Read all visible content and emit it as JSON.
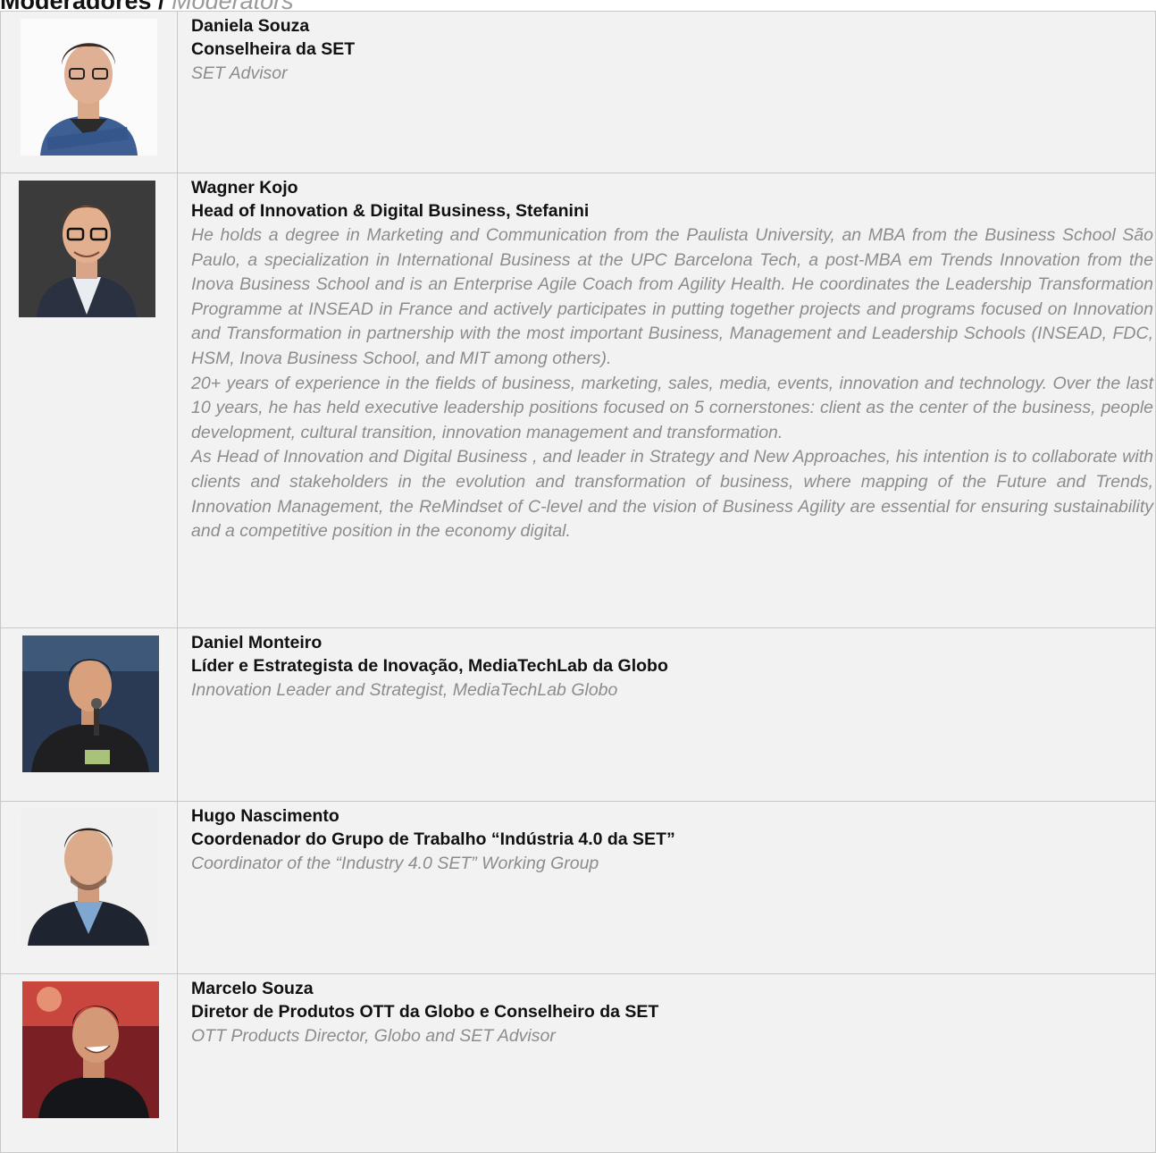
{
  "heading": {
    "pt": "Moderadores",
    "sep": " / ",
    "en": "Moderators"
  },
  "people": [
    {
      "photo": "portrait-photo",
      "name": "Daniela Souza",
      "role": "Conselheira da SET",
      "bio": [
        "SET Advisor"
      ]
    },
    {
      "photo": "portrait-photo",
      "name": "Wagner Kojo",
      "role": "Head of Innovation & Digital Business, Stefanini",
      "bio": [
        "He holds a degree in Marketing and Communication from the Paulista University, an MBA from the Business School São Paulo, a specialization in International Business at the UPC Barcelona Tech, a post-MBA em Trends Innovation from the Inova Business School and is an Enterprise Agile Coach from Agility Health. He coordinates the Leadership Transformation Programme at INSEAD in France and actively participates in putting together projects and programs focused on Innovation and Transformation in partnership with the most important Business, Management and Leadership Schools (INSEAD, FDC, HSM, Inova Business School, and MIT among others).",
        "20+ years of experience in the fields of business, marketing, sales, media, events, innovation and technology. Over the last 10 years, he has held executive leadership positions focused on 5 cornerstones: client as the center of the business, people development, cultural transition, innovation management and transformation.",
        "As Head of Innovation and Digital Business , and leader in Strategy and New Approaches, his intention is to collaborate with clients and stakeholders in the evolution and transformation of business, where mapping of the Future and Trends, Innovation Management, the ReMindset of C-level and the vision of Business Agility are essential for ensuring sustainability and a competitive position in the economy digital."
      ]
    },
    {
      "photo": "portrait-photo",
      "name": "Daniel Monteiro",
      "role": "Líder e Estrategista de Inovação, MediaTechLab da Globo",
      "bio": [
        "Innovation Leader and Strategist, MediaTechLab Globo"
      ]
    },
    {
      "photo": "portrait-photo",
      "name": "Hugo Nascimento",
      "role": "Coordenador do Grupo de Trabalho “Indústria 4.0 da SET”",
      "bio": [
        "Coordinator of the “Industry 4.0 SET” Working Group"
      ]
    },
    {
      "photo": "portrait-photo",
      "name": "Marcelo Souza",
      "role": "Diretor de Produtos OTT da Globo e Conselheiro da SET",
      "bio": [
        "OTT Products Director, Globo and SET Advisor"
      ]
    }
  ]
}
